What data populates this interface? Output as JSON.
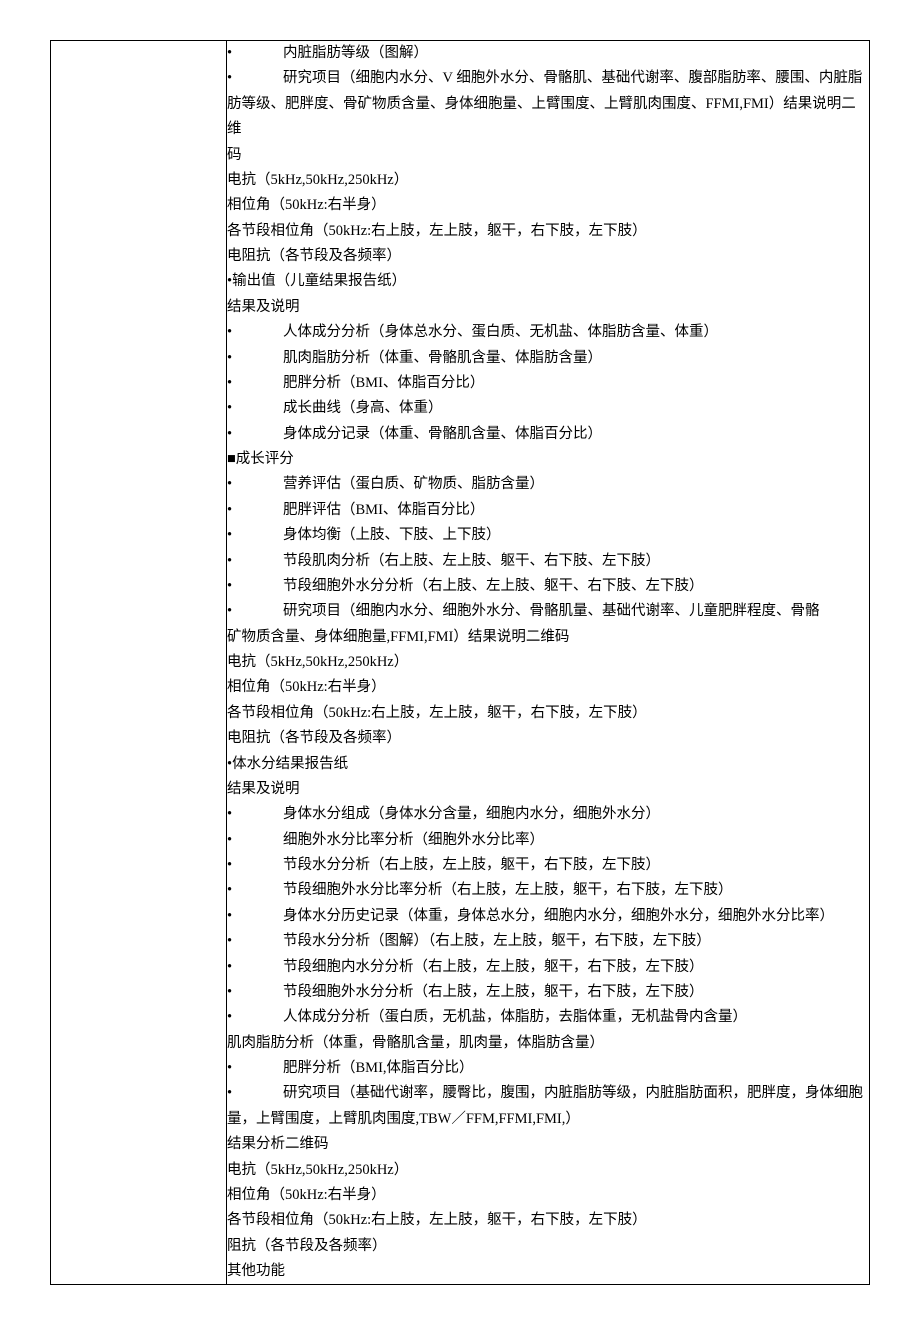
{
  "lines": {
    "l1": "内脏脂肪等级（图解）",
    "l2": "研究项目（细胞内水分、V 细胞外水分、骨骼肌、基础代谢率、腹部脂肪率、腰围、内脏脂",
    "l2b": "肪等级、肥胖度、骨矿物质含量、身体细胞量、上臂围度、上臂肌肉围度、FFMI,FMI）结果说明二维",
    "l2c": "码",
    "l3": "电抗（5kHz,50kHz,250kHz）",
    "l4": "相位角（50kHz:右半身）",
    "l5": "各节段相位角（50kHz:右上肢，左上肢，躯干，右下肢，左下肢）",
    "l6": "电阻抗（各节段及各频率）",
    "l7": "•输出值（儿童结果报告纸）",
    "l8": "结果及说明",
    "l9": "人体成分分析（身体总水分、蛋白质、无机盐、体脂肪含量、体重）",
    "l10": "肌肉脂肪分析（体重、骨骼肌含量、体脂肪含量）",
    "l11": "肥胖分析（BMI、体脂百分比）",
    "l12": "成长曲线（身高、体重）",
    "l13": "身体成分记录（体重、骨骼肌含量、体脂百分比）",
    "l14": "成长评分",
    "l15": "营养评估（蛋白质、矿物质、脂肪含量）",
    "l16": "肥胖评估（BMI、体脂百分比）",
    "l17": "身体均衡（上肢、下肢、上下肢）",
    "l18": "节段肌肉分析（右上肢、左上肢、躯干、右下肢、左下肢）",
    "l19": "节段细胞外水分分析（右上肢、左上肢、躯干、右下肢、左下肢）",
    "l20": "研究项目（细胞内水分、细胞外水分、骨骼肌量、基础代谢率、儿童肥胖程度、骨骼",
    "l20b": "矿物质含量、身体细胞量,FFMI,FMI）结果说明二维码",
    "l21": "电抗（5kHz,50kHz,250kHz）",
    "l22": "相位角（50kHz:右半身）",
    "l23": "各节段相位角（50kHz:右上肢，左上肢，躯干，右下肢，左下肢）",
    "l24": "电阻抗（各节段及各频率）",
    "l25": "•体水分结果报告纸",
    "l26": "结果及说明",
    "l27": "身体水分组成（身体水分含量，细胞内水分，细胞外水分）",
    "l28": "细胞外水分比率分析（细胞外水分比率）",
    "l29": "节段水分分析（右上肢，左上肢，躯干，右下肢，左下肢）",
    "l30": "节段细胞外水分比率分析（右上肢，左上肢，躯干，右下肢，左下肢）",
    "l31": "身体水分历史记录（体重，身体总水分，细胞内水分，细胞外水分，细胞外水分比率）",
    "l32": "节段水分分析（图解）（右上肢，左上肢，躯干，右下肢，左下肢）",
    "l33": "节段细胞内水分分析（右上肢，左上肢，躯干，右下肢，左下肢）",
    "l34": "节段细胞外水分分析（右上肢，左上肢，躯干，右下肢，左下肢）",
    "l35": "人体成分分析（蛋白质，无机盐，体脂肪，去脂体重，无机盐骨内含量）",
    "l36": "肌肉脂肪分析（体重，骨骼肌含量，肌肉量，体脂肪含量）",
    "l37": "肥胖分析（BMI,体脂百分比）",
    "l38": "研究项目（基础代谢率，腰臀比，腹围，内脏脂肪等级，内脏脂肪面积，肥胖度，身体细胞",
    "l38b": "量，上臂围度，上臂肌肉围度,TBW／FFM,FFMI,FMI,）",
    "l39": "结果分析二维码",
    "l40": "电抗（5kHz,50kHz,250kHz）",
    "l41": "相位角（50kHz:右半身）",
    "l42": "各节段相位角（50kHz:右上肢，左上肢，躯干，右下肢，左下肢）",
    "l43": "阻抗（各节段及各频率）",
    "l44": "其他功能"
  }
}
